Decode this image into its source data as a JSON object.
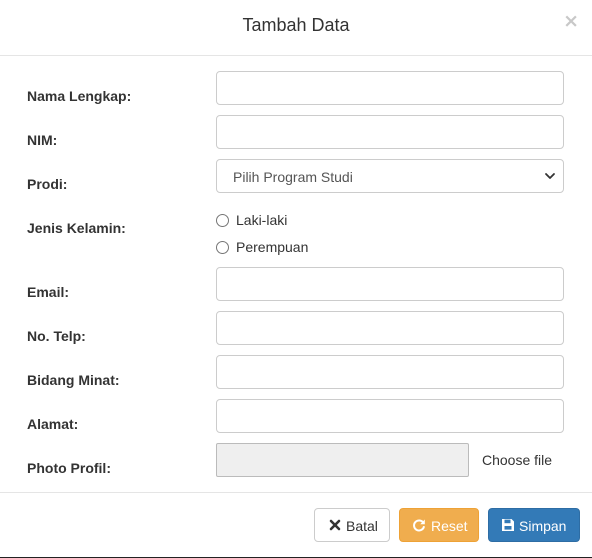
{
  "modal": {
    "title": "Tambah Data",
    "close_glyph": "×"
  },
  "form": {
    "labels": {
      "nama": "Nama Lengkap:",
      "nim": "NIM:",
      "prodi": "Prodi:",
      "jenis_kelamin": "Jenis Kelamin:",
      "email": "Email:",
      "telp": "No. Telp:",
      "bidang": "Bidang Minat:",
      "alamat": "Alamat:",
      "photo": "Photo Profil:"
    },
    "values": {
      "nama": "",
      "nim": "",
      "email": "",
      "telp": "",
      "bidang": "",
      "alamat": ""
    },
    "prodi_selected": "Pilih Program Studi",
    "gender_options": [
      "Laki-laki",
      "Perempuan"
    ],
    "file_button": "Choose file"
  },
  "footer": {
    "batal": "Batal",
    "reset": "Reset",
    "simpan": "Simpan"
  },
  "colors": {
    "reset_bg": "#f0ad4e",
    "simpan_bg": "#337ab7",
    "border": "#cccccc"
  },
  "icons": {
    "close": "close-icon",
    "select": "chevron-down-icon",
    "batal": "times-icon",
    "reset": "refresh-icon",
    "simpan": "save-icon"
  }
}
